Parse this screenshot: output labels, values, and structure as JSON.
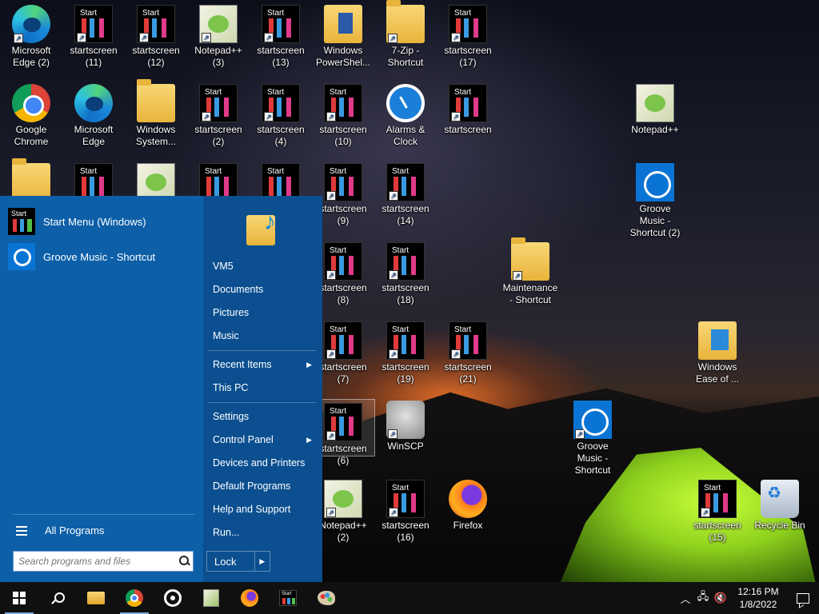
{
  "desktop": {
    "icons": [
      {
        "label": "Microsoft Edge (2)",
        "icon": "edge-icon"
      },
      {
        "label": "startscreen (11)",
        "icon": "startscreen-icon"
      },
      {
        "label": "startscreen (12)",
        "icon": "startscreen-icon"
      },
      {
        "label": "Notepad++ (3)",
        "icon": "notepadpp-icon"
      },
      {
        "label": "startscreen (13)",
        "icon": "startscreen-icon"
      },
      {
        "label": "Windows PowerShel...",
        "icon": "powershell-folder-icon"
      },
      {
        "label": "7-Zip - Shortcut",
        "icon": "folder-icon"
      },
      {
        "label": "startscreen (17)",
        "icon": "startscreen-icon"
      },
      {
        "label": "Google Chrome",
        "icon": "chrome-icon"
      },
      {
        "label": "Microsoft Edge",
        "icon": "edge-icon"
      },
      {
        "label": "Windows System...",
        "icon": "folder-icon"
      },
      {
        "label": "startscreen (2)",
        "icon": "startscreen-icon"
      },
      {
        "label": "startscreen (4)",
        "icon": "startscreen-icon"
      },
      {
        "label": "startscreen (10)",
        "icon": "startscreen-icon"
      },
      {
        "label": "Alarms & Clock",
        "icon": "alarm-clock-icon"
      },
      {
        "label": "startscreen",
        "icon": "startscreen-icon"
      },
      {
        "label": "Notepad++",
        "icon": "notepadpp-icon"
      },
      {
        "label": "",
        "icon": "folder-icon"
      },
      {
        "label": "",
        "icon": "startscreen-icon"
      },
      {
        "label": "",
        "icon": "notepadpp-icon"
      },
      {
        "label": "",
        "icon": "startscreen-icon"
      },
      {
        "label": "",
        "icon": "startscreen-icon"
      },
      {
        "label": "startscreen (9)",
        "icon": "startscreen-icon"
      },
      {
        "label": "startscreen (14)",
        "icon": "startscreen-icon"
      },
      {
        "label": "Groove Music - Shortcut (2)",
        "icon": "groove-music-icon"
      },
      {
        "label": "startscreen (8)",
        "icon": "startscreen-icon"
      },
      {
        "label": "startscreen (18)",
        "icon": "startscreen-icon"
      },
      {
        "label": "Maintenance - Shortcut",
        "icon": "folder-icon"
      },
      {
        "label": "startscreen (7)",
        "icon": "startscreen-icon"
      },
      {
        "label": "startscreen (19)",
        "icon": "startscreen-icon"
      },
      {
        "label": "startscreen (21)",
        "icon": "startscreen-icon"
      },
      {
        "label": "Windows Ease of ...",
        "icon": "ease-of-access-folder-icon"
      },
      {
        "label": "startscreen (6)",
        "icon": "startscreen-icon"
      },
      {
        "label": "WinSCP",
        "icon": "winscp-icon"
      },
      {
        "label": "Groove Music - Shortcut",
        "icon": "groove-music-icon"
      },
      {
        "label": "Notepad++ (2)",
        "icon": "notepadpp-icon"
      },
      {
        "label": "startscreen (16)",
        "icon": "startscreen-icon"
      },
      {
        "label": "Firefox",
        "icon": "firefox-icon"
      },
      {
        "label": "startscreen (15)",
        "icon": "startscreen-icon"
      },
      {
        "label": "Recycle Bin",
        "icon": "recycle-bin-icon"
      }
    ],
    "startscreen_thumb_text": "Start"
  },
  "start_menu": {
    "pinned": [
      {
        "label": "Start Menu (Windows)",
        "icon": "start-menu-icon",
        "thumb_text": "Start"
      },
      {
        "label": "Groove Music - Shortcut",
        "icon": "groove-music-icon"
      }
    ],
    "all_programs": "All Programs",
    "search_placeholder": "Search programs and files",
    "right": {
      "user": "VM5",
      "documents": "Documents",
      "pictures": "Pictures",
      "music": "Music",
      "recent_items": "Recent Items",
      "this_pc": "This PC",
      "settings": "Settings",
      "control_panel": "Control Panel",
      "devices_printers": "Devices and Printers",
      "default_programs": "Default Programs",
      "help_support": "Help and Support",
      "run": "Run...",
      "lock": "Lock"
    },
    "accent": "#0d5fa8"
  },
  "taskbar": {
    "items": [
      "windows-logo-icon",
      "search-icon",
      "file-explorer-icon",
      "chrome-icon",
      "groove-music-icon",
      "notepadpp-icon",
      "firefox-icon",
      "startscreen-icon",
      "paint-icon"
    ],
    "time": "12:16 PM",
    "date": "1/8/2022"
  }
}
